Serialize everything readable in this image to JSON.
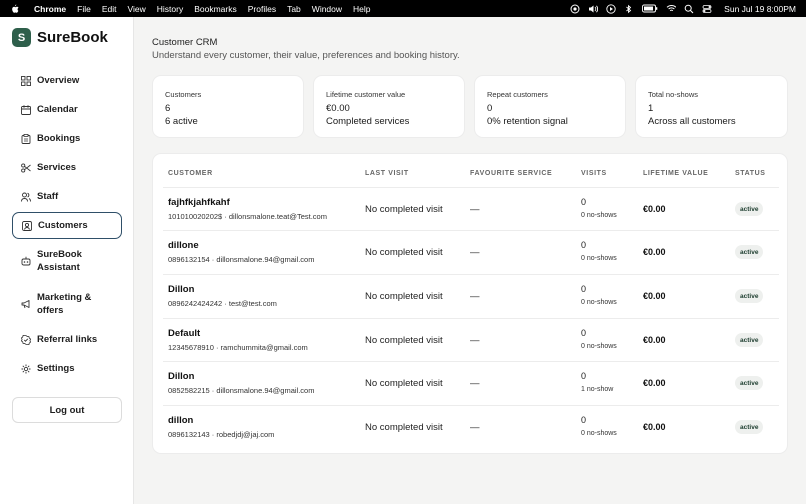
{
  "menubar": {
    "app": "Chrome",
    "items": [
      "File",
      "Edit",
      "View",
      "History",
      "Bookmarks",
      "Profiles",
      "Tab",
      "Window",
      "Help"
    ],
    "clock": "Sun Jul 19  8:00PM"
  },
  "brand": {
    "logo_letter": "S",
    "name": "SureBook"
  },
  "nav": [
    {
      "label": "Overview",
      "icon": "grid-icon"
    },
    {
      "label": "Calendar",
      "icon": "calendar-icon"
    },
    {
      "label": "Bookings",
      "icon": "clipboard-icon"
    },
    {
      "label": "Services",
      "icon": "scissors-icon"
    },
    {
      "label": "Staff",
      "icon": "users-icon"
    },
    {
      "label": "Customers",
      "icon": "id-card-icon",
      "active": true
    },
    {
      "label": "SureBook Assistant",
      "icon": "robot-icon"
    },
    {
      "label": "Marketing & offers",
      "icon": "megaphone-icon"
    },
    {
      "label": "Referral links",
      "icon": "badge-icon"
    },
    {
      "label": "Settings",
      "icon": "gear-icon"
    }
  ],
  "logout_label": "Log out",
  "header": {
    "title": "Customer CRM",
    "subtitle": "Understand every customer, their value, preferences and booking history."
  },
  "stats": [
    {
      "label": "Customers",
      "value": "6",
      "sub": "6 active"
    },
    {
      "label": "Lifetime customer value",
      "value": "€0.00",
      "sub": "Completed services"
    },
    {
      "label": "Repeat customers",
      "value": "0",
      "sub": "0% retention signal"
    },
    {
      "label": "Total no-shows",
      "value": "1",
      "sub": "Across all customers"
    }
  ],
  "table": {
    "headers": {
      "customer": "CUSTOMER",
      "last_visit": "LAST VISIT",
      "favourite": "FAVOURITE SERVICE",
      "visits": "VISITS",
      "ltv": "LIFETIME VALUE",
      "status": "STATUS"
    },
    "rows": [
      {
        "name": "fajhfkjahfkahf",
        "contact": "101010020202$ · dillonsmalone.teat@Test.com",
        "last_visit": "No completed visit",
        "favourite": "—",
        "visits": "0",
        "noshows": "0 no-shows",
        "ltv": "€0.00",
        "status": "active"
      },
      {
        "name": "dillone",
        "contact": "0896132154 · dillonsmalone.94@gmail.com",
        "last_visit": "No completed visit",
        "favourite": "—",
        "visits": "0",
        "noshows": "0 no-shows",
        "ltv": "€0.00",
        "status": "active"
      },
      {
        "name": "Dillon",
        "contact": "0896242424242 · test@test.com",
        "last_visit": "No completed visit",
        "favourite": "—",
        "visits": "0",
        "noshows": "0 no-shows",
        "ltv": "€0.00",
        "status": "active"
      },
      {
        "name": "Default",
        "contact": "12345678910 · ramchummita@gmail.com",
        "last_visit": "No completed visit",
        "favourite": "—",
        "visits": "0",
        "noshows": "0 no-shows",
        "ltv": "€0.00",
        "status": "active"
      },
      {
        "name": "Dillon",
        "contact": "0852582215 · dillonsmalone.94@gmail.com",
        "last_visit": "No completed visit",
        "favourite": "—",
        "visits": "0",
        "noshows": "1 no-show",
        "ltv": "€0.00",
        "status": "active"
      },
      {
        "name": "dillon",
        "contact": "0896132143 · robedjdj@jaj.com",
        "last_visit": "No completed visit",
        "favourite": "—",
        "visits": "0",
        "noshows": "0 no-shows",
        "ltv": "€0.00",
        "status": "active"
      }
    ]
  },
  "colors": {
    "brand": "#2e5f4b",
    "active_border": "#2f4f68"
  }
}
